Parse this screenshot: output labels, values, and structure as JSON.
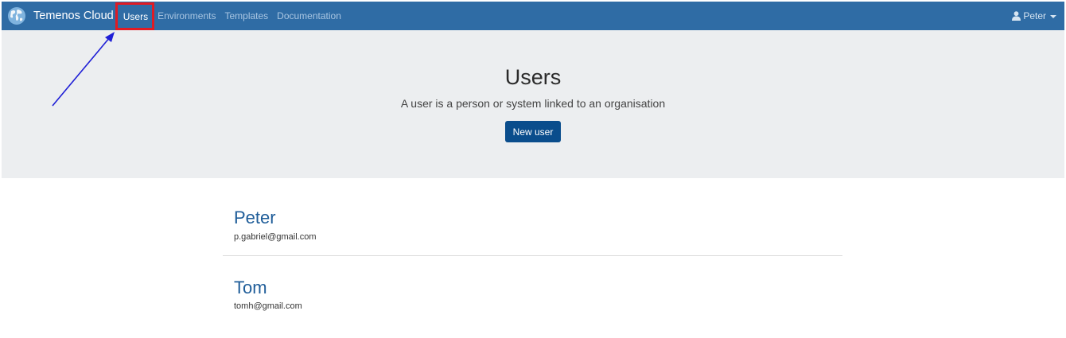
{
  "navbar": {
    "brand": "Temenos Cloud",
    "links": [
      {
        "label": "Users",
        "active": true
      },
      {
        "label": "Environments",
        "active": false
      },
      {
        "label": "Templates",
        "active": false
      },
      {
        "label": "Documentation",
        "active": false
      }
    ],
    "user_menu": {
      "label": "Peter",
      "icon": "user-icon"
    }
  },
  "jumbotron": {
    "title": "Users",
    "subtitle": "A user is a person or system linked to an organisation",
    "button_label": "New user"
  },
  "users": [
    {
      "name": "Peter",
      "email": "p.gabriel@gmail.com"
    },
    {
      "name": "Tom",
      "email": "tomh@gmail.com"
    }
  ],
  "colors": {
    "navbar_bg": "#2f6ca5",
    "primary_button": "#0a4d8c",
    "link": "#1f5d99",
    "highlight_box": "#e01b24",
    "annotation_arrow": "#1f1fd6"
  }
}
